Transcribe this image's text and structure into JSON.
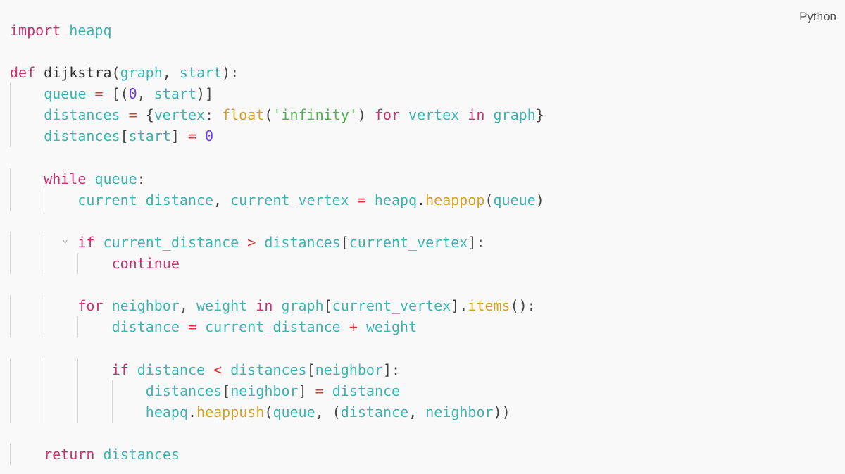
{
  "language_label": "Python",
  "colors": {
    "keyword": "#c7336f",
    "variable": "#3db5b0",
    "function": "#d6a324",
    "number": "#6b3cf0",
    "string": "#4bb34b",
    "operator": "#e0353a",
    "background": "#f9f9f9"
  },
  "fold_icon": "chevron-down-icon",
  "lines": [
    {
      "indent": 0,
      "tokens": [
        [
          "k",
          "import"
        ],
        [
          "p",
          " "
        ],
        [
          "v",
          "heapq"
        ]
      ]
    },
    {
      "indent": 0,
      "tokens": []
    },
    {
      "indent": 0,
      "tokens": [
        [
          "k",
          "def"
        ],
        [
          "p",
          " "
        ],
        [
          "d",
          "dijkstra"
        ],
        [
          "p",
          "("
        ],
        [
          "v",
          "graph"
        ],
        [
          "p",
          ", "
        ],
        [
          "v",
          "start"
        ],
        [
          "p",
          "):"
        ]
      ]
    },
    {
      "indent": 1,
      "tokens": [
        [
          "v",
          "queue"
        ],
        [
          "p",
          " "
        ],
        [
          "o",
          "="
        ],
        [
          "p",
          " [("
        ],
        [
          "n",
          "0"
        ],
        [
          "p",
          ", "
        ],
        [
          "v",
          "start"
        ],
        [
          "p",
          ")]"
        ]
      ]
    },
    {
      "indent": 1,
      "tokens": [
        [
          "v",
          "distances"
        ],
        [
          "p",
          " "
        ],
        [
          "o",
          "="
        ],
        [
          "p",
          " {"
        ],
        [
          "v",
          "vertex"
        ],
        [
          "p",
          ": "
        ],
        [
          "f",
          "float"
        ],
        [
          "p",
          "("
        ],
        [
          "s",
          "'infinity'"
        ],
        [
          "p",
          ") "
        ],
        [
          "k",
          "for"
        ],
        [
          "p",
          " "
        ],
        [
          "v",
          "vertex"
        ],
        [
          "p",
          " "
        ],
        [
          "k",
          "in"
        ],
        [
          "p",
          " "
        ],
        [
          "v",
          "graph"
        ],
        [
          "p",
          "}"
        ]
      ]
    },
    {
      "indent": 1,
      "tokens": [
        [
          "v",
          "distances"
        ],
        [
          "p",
          "["
        ],
        [
          "v",
          "start"
        ],
        [
          "p",
          "] "
        ],
        [
          "o",
          "="
        ],
        [
          "p",
          " "
        ],
        [
          "n",
          "0"
        ]
      ]
    },
    {
      "indent": 0,
      "tokens": []
    },
    {
      "indent": 1,
      "tokens": [
        [
          "k",
          "while"
        ],
        [
          "p",
          " "
        ],
        [
          "v",
          "queue"
        ],
        [
          "p",
          ":"
        ]
      ]
    },
    {
      "indent": 2,
      "tokens": [
        [
          "v",
          "current_distance"
        ],
        [
          "p",
          ", "
        ],
        [
          "v",
          "current_vertex"
        ],
        [
          "p",
          " "
        ],
        [
          "o",
          "="
        ],
        [
          "p",
          " "
        ],
        [
          "v",
          "heapq"
        ],
        [
          "p",
          "."
        ],
        [
          "f",
          "heappop"
        ],
        [
          "p",
          "("
        ],
        [
          "v",
          "queue"
        ],
        [
          "p",
          ")"
        ]
      ]
    },
    {
      "indent": 0,
      "tokens": []
    },
    {
      "indent": 2,
      "fold": true,
      "tokens": [
        [
          "k",
          "if"
        ],
        [
          "p",
          " "
        ],
        [
          "v",
          "current_distance"
        ],
        [
          "p",
          " "
        ],
        [
          "o",
          ">"
        ],
        [
          "p",
          " "
        ],
        [
          "v",
          "distances"
        ],
        [
          "p",
          "["
        ],
        [
          "v",
          "current_vertex"
        ],
        [
          "p",
          "]:"
        ]
      ]
    },
    {
      "indent": 3,
      "tokens": [
        [
          "k",
          "continue"
        ]
      ]
    },
    {
      "indent": 0,
      "tokens": []
    },
    {
      "indent": 2,
      "tokens": [
        [
          "k",
          "for"
        ],
        [
          "p",
          " "
        ],
        [
          "v",
          "neighbor"
        ],
        [
          "p",
          ", "
        ],
        [
          "v",
          "weight"
        ],
        [
          "p",
          " "
        ],
        [
          "k",
          "in"
        ],
        [
          "p",
          " "
        ],
        [
          "v",
          "graph"
        ],
        [
          "p",
          "["
        ],
        [
          "v",
          "current_vertex"
        ],
        [
          "p",
          "]."
        ],
        [
          "f",
          "items"
        ],
        [
          "p",
          "():"
        ]
      ]
    },
    {
      "indent": 3,
      "tokens": [
        [
          "v",
          "distance"
        ],
        [
          "p",
          " "
        ],
        [
          "o",
          "="
        ],
        [
          "p",
          " "
        ],
        [
          "v",
          "current_distance"
        ],
        [
          "p",
          " "
        ],
        [
          "o",
          "+"
        ],
        [
          "p",
          " "
        ],
        [
          "v",
          "weight"
        ]
      ]
    },
    {
      "indent": 0,
      "tokens": []
    },
    {
      "indent": 3,
      "tokens": [
        [
          "k",
          "if"
        ],
        [
          "p",
          " "
        ],
        [
          "v",
          "distance"
        ],
        [
          "p",
          " "
        ],
        [
          "o",
          "<"
        ],
        [
          "p",
          " "
        ],
        [
          "v",
          "distances"
        ],
        [
          "p",
          "["
        ],
        [
          "v",
          "neighbor"
        ],
        [
          "p",
          "]:"
        ]
      ]
    },
    {
      "indent": 4,
      "tokens": [
        [
          "v",
          "distances"
        ],
        [
          "p",
          "["
        ],
        [
          "v",
          "neighbor"
        ],
        [
          "p",
          "] "
        ],
        [
          "o",
          "="
        ],
        [
          "p",
          " "
        ],
        [
          "v",
          "distance"
        ]
      ]
    },
    {
      "indent": 4,
      "tokens": [
        [
          "v",
          "heapq"
        ],
        [
          "p",
          "."
        ],
        [
          "f",
          "heappush"
        ],
        [
          "p",
          "("
        ],
        [
          "v",
          "queue"
        ],
        [
          "p",
          ", ("
        ],
        [
          "v",
          "distance"
        ],
        [
          "p",
          ", "
        ],
        [
          "v",
          "neighbor"
        ],
        [
          "p",
          "))"
        ]
      ]
    },
    {
      "indent": 0,
      "tokens": []
    },
    {
      "indent": 1,
      "tokens": [
        [
          "k",
          "return"
        ],
        [
          "p",
          " "
        ],
        [
          "v",
          "distances"
        ]
      ]
    }
  ]
}
